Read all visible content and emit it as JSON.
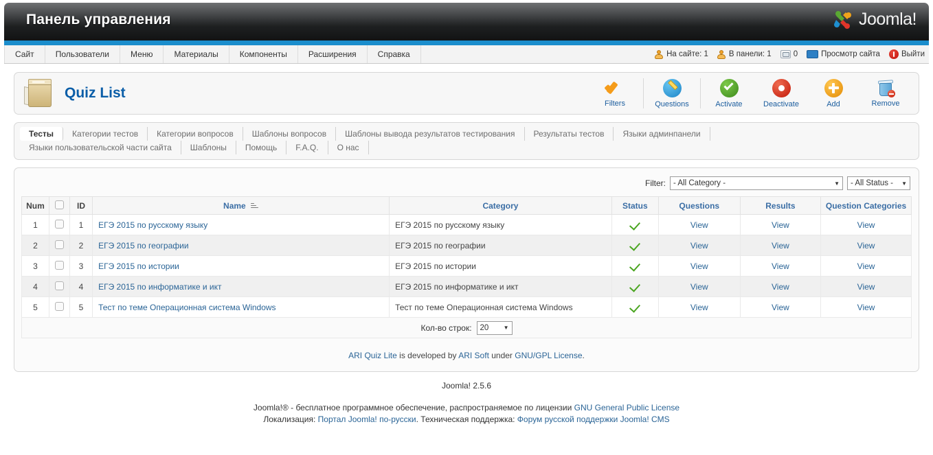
{
  "header": {
    "title": "Панель управления",
    "logo_text": "Joomla!"
  },
  "menubar": {
    "items": [
      {
        "label": "Сайт"
      },
      {
        "label": "Пользователи"
      },
      {
        "label": "Меню"
      },
      {
        "label": "Материалы"
      },
      {
        "label": "Компоненты"
      },
      {
        "label": "Расширения"
      },
      {
        "label": "Справка"
      }
    ],
    "status": {
      "visitors": "На сайте: 1",
      "admins": "В панели: 1",
      "messages": "0",
      "preview": "Просмотр сайта",
      "logout": "Выйти"
    }
  },
  "toolbar": {
    "page_title": "Quiz List",
    "buttons": [
      {
        "label": "Filters",
        "icon": "filter-check-icon"
      },
      {
        "label": "Questions",
        "icon": "pencil-circle-icon"
      },
      {
        "label": "Activate",
        "icon": "green-check-icon"
      },
      {
        "label": "Deactivate",
        "icon": "red-dot-icon"
      },
      {
        "label": "Add",
        "icon": "plus-icon"
      },
      {
        "label": "Remove",
        "icon": "trash-icon"
      }
    ]
  },
  "tabs": [
    {
      "label": "Тесты",
      "active": true
    },
    {
      "label": "Категории тестов",
      "active": false
    },
    {
      "label": "Категории вопросов",
      "active": false
    },
    {
      "label": "Шаблоны вопросов",
      "active": false
    },
    {
      "label": "Шаблоны вывода результатов тестирования",
      "active": false
    },
    {
      "label": "Результаты тестов",
      "active": false
    },
    {
      "label": "Языки админпанели",
      "active": false
    },
    {
      "label": "Языки пользовательской части сайта",
      "active": false
    },
    {
      "label": "Шаблоны",
      "active": false
    },
    {
      "label": "Помощь",
      "active": false
    },
    {
      "label": "F.A.Q.",
      "active": false
    },
    {
      "label": "О нас",
      "active": false
    }
  ],
  "filter": {
    "label": "Filter:",
    "category_value": "- All Category -",
    "status_value": "- All Status -"
  },
  "table": {
    "headers": {
      "num": "Num",
      "id": "ID",
      "name": "Name",
      "category": "Category",
      "status": "Status",
      "questions": "Questions",
      "results": "Results",
      "question_categories": "Question Categories"
    },
    "rows": [
      {
        "num": "1",
        "id": "1",
        "name": "ЕГЭ 2015 по русскому языку",
        "category": "ЕГЭ 2015 по русскому языку",
        "questions": "View",
        "results": "View",
        "question_categories": "View"
      },
      {
        "num": "2",
        "id": "2",
        "name": "ЕГЭ 2015 по географии",
        "category": "ЕГЭ 2015 по географии",
        "questions": "View",
        "results": "View",
        "question_categories": "View"
      },
      {
        "num": "3",
        "id": "3",
        "name": "ЕГЭ 2015 по истории",
        "category": "ЕГЭ 2015 по истории",
        "questions": "View",
        "results": "View",
        "question_categories": "View"
      },
      {
        "num": "4",
        "id": "4",
        "name": "ЕГЭ 2015 по информатике и икт",
        "category": "ЕГЭ 2015 по информатике и икт",
        "questions": "View",
        "results": "View",
        "question_categories": "View"
      },
      {
        "num": "5",
        "id": "5",
        "name": "Тест по теме Операционная система Windows",
        "category": "Тест по теме Операционная система Windows",
        "questions": "View",
        "results": "View",
        "question_categories": "View"
      }
    ]
  },
  "rows_bar": {
    "label": "Кол-во строк:",
    "value": "20"
  },
  "credit": {
    "product": "ARI Quiz Lite",
    "mid": " is developed by ",
    "vendor": "ARI Soft",
    "mid2": " under ",
    "license": "GNU/GPL License",
    "end": "."
  },
  "footer": {
    "version": "Joomla! 2.5.6",
    "line1_pre": "Joomla!® - бесплатное программное обеспечение, распространяемое по лицензии ",
    "line1_link": "GNU General Public License",
    "line2_pre": "Локализация: ",
    "line2_link1": "Портал Joomla! по-русски",
    "line2_mid": ". Техническая поддержка: ",
    "line2_link2": "Форум русской поддержки Joomla! CMS"
  }
}
